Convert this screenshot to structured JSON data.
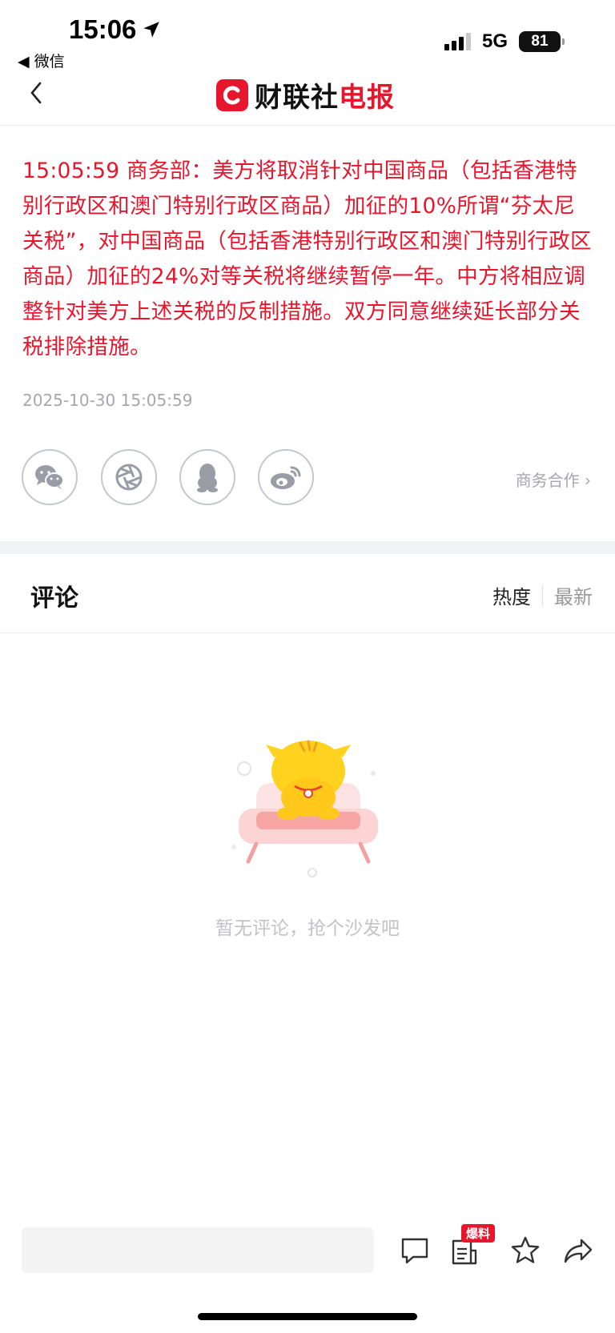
{
  "status_bar": {
    "time": "15:06",
    "back_app": "◀ 微信",
    "network": "5G",
    "battery": "81"
  },
  "nav": {
    "logo_black": "财联社",
    "logo_red": "电报"
  },
  "article": {
    "content": "15:05:59 商务部：美方将取消针对中国商品（包括香港特别行政区和澳门特别行政区商品）加征的10%所谓“芬太尼关税”，对中国商品（包括香港特别行政区和澳门特别行政区商品）加征的24%对等关税将继续暂停一年。中方将相应调整针对美方上述关税的反制措施。双方同意继续延长部分关税排除措施。",
    "timestamp": "2025-10-30 15:05:59"
  },
  "share": {
    "icons": [
      "wechat-icon",
      "moments-icon",
      "qq-icon",
      "weibo-icon"
    ],
    "business_link": "商务合作 ›"
  },
  "comments": {
    "title": "评论",
    "sort_hot": "热度",
    "sort_new": "最新",
    "empty_text": "暂无评论，抢个沙发吧"
  },
  "bottom_bar": {
    "badge": "爆料"
  },
  "colors": {
    "accent": "#e8162c",
    "muted": "#a6a6b0"
  }
}
